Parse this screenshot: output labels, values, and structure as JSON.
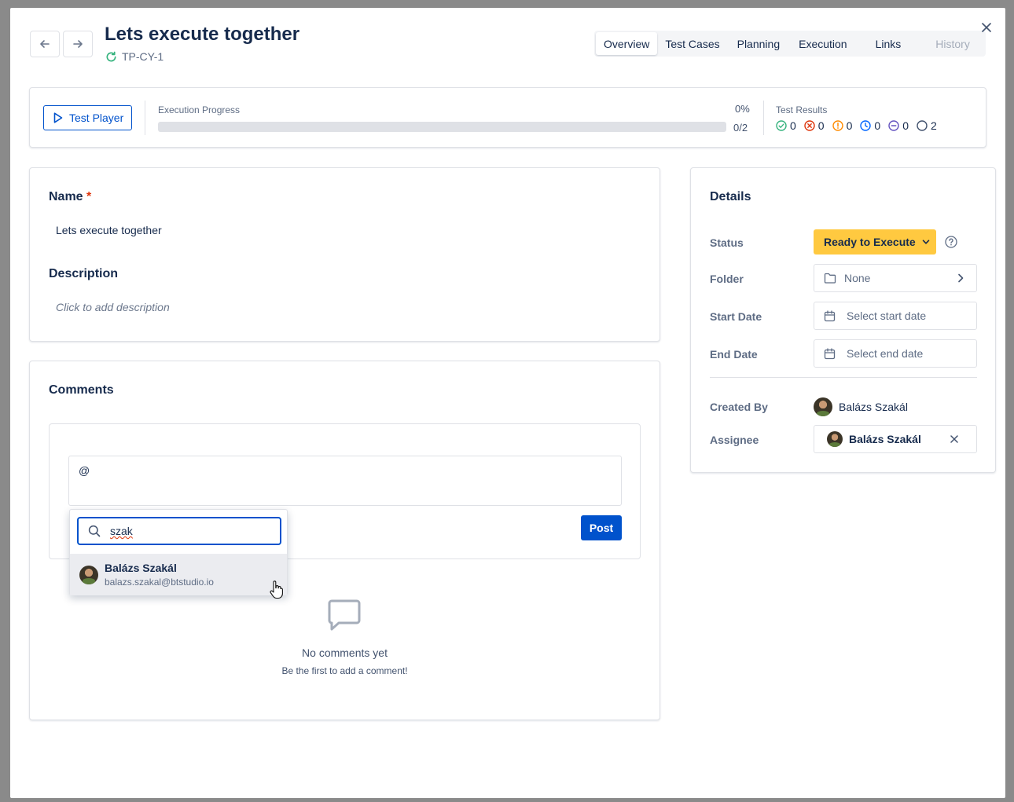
{
  "header": {
    "title": "Lets execute together",
    "key": "TP-CY-1",
    "back_icon": "arrow-left-icon",
    "forward_icon": "arrow-right-icon"
  },
  "tabs": [
    {
      "label": "Overview",
      "active": true
    },
    {
      "label": "Test Cases"
    },
    {
      "label": "Planning"
    },
    {
      "label": "Execution"
    },
    {
      "label": "Links"
    },
    {
      "label": "History",
      "disabled": true
    }
  ],
  "progress": {
    "player_label": "Test Player",
    "execution_label": "Execution Progress",
    "percent_text": "0%",
    "count_text": "0/2",
    "fraction": 0,
    "results_label": "Test Results",
    "results": [
      {
        "icon": "check-circle-icon",
        "count": "0",
        "color": "#36b37e"
      },
      {
        "icon": "x-circle-icon",
        "count": "0",
        "color": "#de350b"
      },
      {
        "icon": "alert-circle-icon",
        "count": "0",
        "color": "#ff8b00"
      },
      {
        "icon": "clock-circle-icon",
        "count": "0",
        "color": "#0065ff"
      },
      {
        "icon": "minus-circle-icon",
        "count": "0",
        "color": "#6554c0"
      },
      {
        "icon": "empty-circle-icon",
        "count": "2",
        "color": "#42526e"
      }
    ]
  },
  "form": {
    "name_label": "Name",
    "required_mark": "*",
    "name_value": "Lets execute together",
    "description_label": "Description",
    "description_placeholder": "Click to add description"
  },
  "comments": {
    "title": "Comments",
    "input_value": "@",
    "post_label": "Post",
    "empty_title": "No comments yet",
    "empty_sub": "Be the first to add a comment!"
  },
  "mention": {
    "search_value": "szak",
    "user_name": "Balázs Szakál",
    "user_email": "balazs.szakal@btstudio.io"
  },
  "details": {
    "title": "Details",
    "status_label": "Status",
    "status_value": "Ready to Execute",
    "status_color": "#ffc940",
    "folder_label": "Folder",
    "folder_value": "None",
    "start_label": "Start Date",
    "start_placeholder": "Select start date",
    "end_label": "End Date",
    "end_placeholder": "Select end date",
    "created_label": "Created By",
    "created_value": "Balázs Szakál",
    "assignee_label": "Assignee",
    "assignee_value": "Balázs Szakál"
  }
}
